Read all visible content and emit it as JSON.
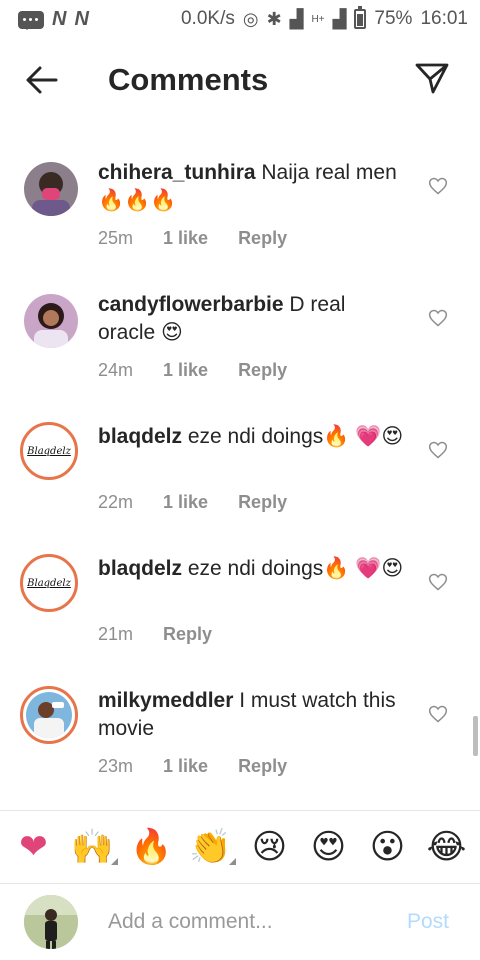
{
  "status_bar": {
    "speed": "0.0K/s",
    "network_badge": "H+",
    "battery": "75%",
    "time": "16:01",
    "n_icon_1": "N",
    "n_icon_2": "N"
  },
  "header": {
    "title": "Comments",
    "back_icon": "arrow-left-icon",
    "send_icon": "paper-plane-icon"
  },
  "comments": [
    {
      "username": "chihera_tunhira",
      "text": "Naija real men 🔥🔥🔥",
      "time": "25m",
      "likes": "1 like",
      "reply": "Reply",
      "avatar": "photo"
    },
    {
      "username": "candyflowerbarbie",
      "text": "D real oracle 😍",
      "time": "24m",
      "likes": "1 like",
      "reply": "Reply",
      "avatar": "photo"
    },
    {
      "username": "blaqdelz",
      "text": "eze ndi doings🔥 💗😍",
      "time": "22m",
      "likes": "1 like",
      "reply": "Reply",
      "avatar": "Blaqdelz"
    },
    {
      "username": "blaqdelz",
      "text": "eze ndi doings🔥 💗😍",
      "time": "21m",
      "likes": "",
      "reply": "Reply",
      "avatar": "Blaqdelz"
    },
    {
      "username": "milkymeddler",
      "text": "I must watch this movie",
      "time": "23m",
      "likes": "1 like",
      "reply": "Reply",
      "avatar": "photo"
    }
  ],
  "emoji_bar": [
    "❤",
    "🙌",
    "🔥",
    "👏",
    "😢",
    "😍",
    "😮",
    "😂"
  ],
  "composer": {
    "placeholder": "Add a comment...",
    "post_label": "Post"
  },
  "colors": {
    "text": "#262626",
    "meta": "#8e8e8e",
    "post_disabled": "#b3dbff",
    "story_ring": "#d9346b"
  }
}
